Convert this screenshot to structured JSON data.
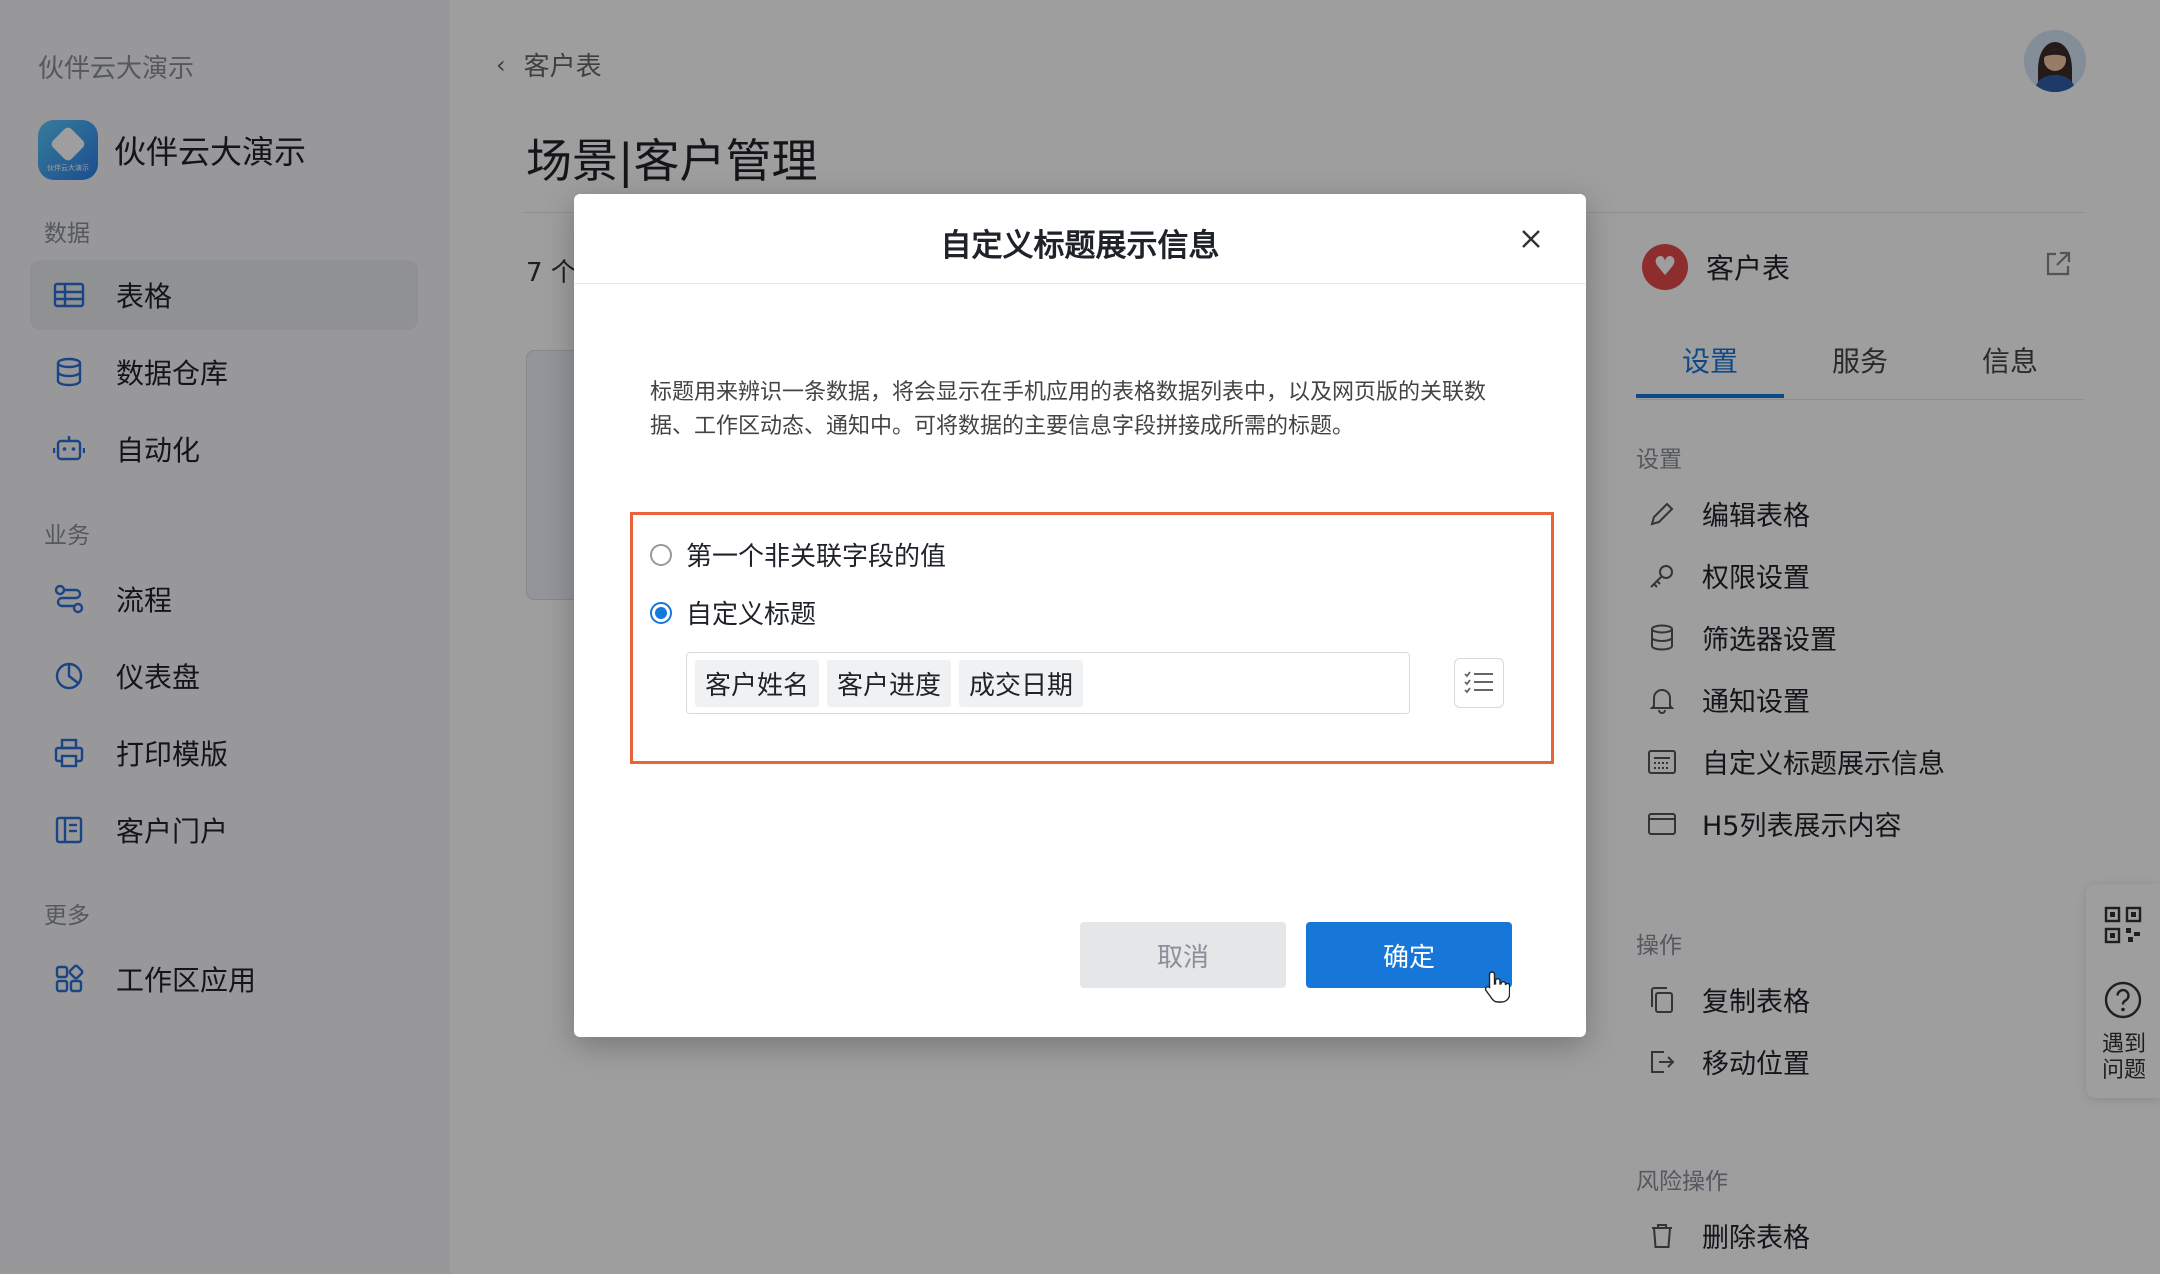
{
  "workspace_name": "伙伴云大演示",
  "app": {
    "title": "伙伴云大演示",
    "logo_text": "伙伴云大演示"
  },
  "sidebar": {
    "sections": [
      {
        "label": "数据",
        "items": [
          {
            "label": "表格",
            "icon": "table-icon",
            "active": true
          },
          {
            "label": "数据仓库",
            "icon": "database-icon",
            "active": false
          },
          {
            "label": "自动化",
            "icon": "robot-icon",
            "active": false
          }
        ]
      },
      {
        "label": "业务",
        "items": [
          {
            "label": "流程",
            "icon": "flow-icon",
            "active": false
          },
          {
            "label": "仪表盘",
            "icon": "pie-chart-icon",
            "active": false
          },
          {
            "label": "打印模版",
            "icon": "printer-icon",
            "active": false
          },
          {
            "label": "客户门户",
            "icon": "portal-icon",
            "active": false
          }
        ]
      },
      {
        "label": "更多",
        "items": [
          {
            "label": "工作区应用",
            "icon": "apps-grid-icon",
            "active": false
          }
        ]
      }
    ]
  },
  "main": {
    "breadcrumb": "客户表",
    "page_title": "场景|客户管理",
    "count_text": "7 个"
  },
  "right_panel": {
    "table_name": "客户表",
    "tabs": [
      {
        "label": "设置",
        "active": true
      },
      {
        "label": "服务",
        "active": false
      },
      {
        "label": "信息",
        "active": false
      }
    ],
    "settings_label": "设置",
    "settings_items": [
      {
        "label": "编辑表格",
        "icon": "pencil-icon"
      },
      {
        "label": "权限设置",
        "icon": "key-icon"
      },
      {
        "label": "筛选器设置",
        "icon": "database-icon"
      },
      {
        "label": "通知设置",
        "icon": "bell-icon"
      },
      {
        "label": "自定义标题展示信息",
        "icon": "title-display-icon"
      },
      {
        "label": "H5列表展示内容",
        "icon": "window-icon"
      }
    ],
    "operations_label": "操作",
    "operation_items": [
      {
        "label": "复制表格",
        "icon": "copy-icon"
      },
      {
        "label": "移动位置",
        "icon": "move-out-icon"
      }
    ],
    "danger_label": "风险操作",
    "danger_items": [
      {
        "label": "删除表格",
        "icon": "trash-icon"
      }
    ]
  },
  "floating": {
    "help_label": "遇到问题"
  },
  "modal": {
    "title": "自定义标题展示信息",
    "description": "标题用来辨识一条数据，将会显示在手机应用的表格数据列表中，以及网页版的关联数据、工作区动态、通知中。可将数据的主要信息字段拼接成所需的标题。",
    "options": [
      {
        "label": "第一个非关联字段的值",
        "checked": false
      },
      {
        "label": "自定义标题",
        "checked": true
      }
    ],
    "title_fields": [
      "客户姓名",
      "客户进度",
      "成交日期"
    ],
    "cancel_label": "取消",
    "confirm_label": "确定",
    "accent_color": "#1677d9",
    "highlight_color": "#e8643a"
  }
}
